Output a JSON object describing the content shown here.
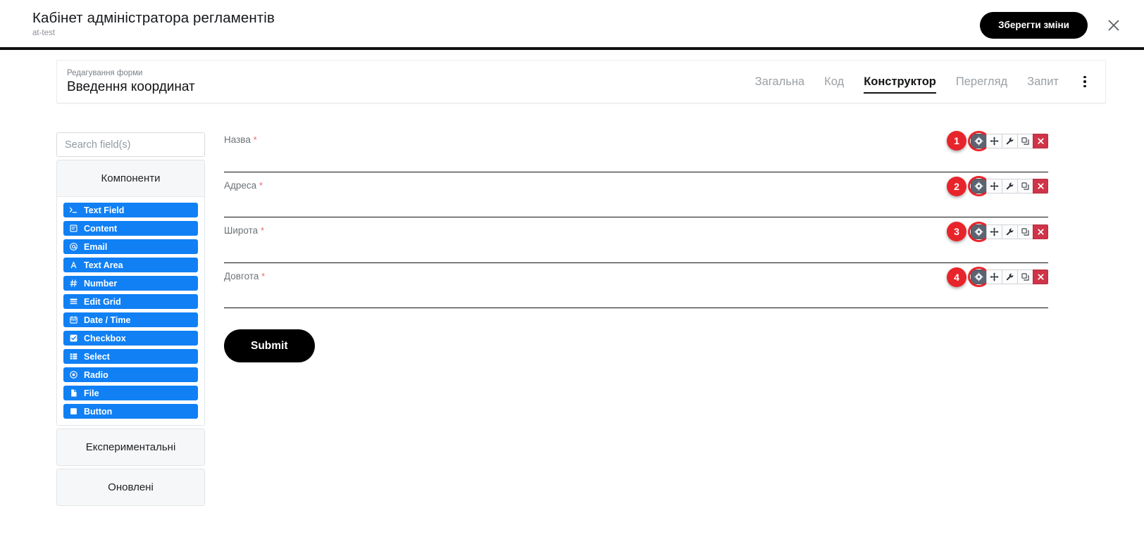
{
  "topbar": {
    "app_title": "Кабінет адміністратора регламентів",
    "app_subtitle": "at-test",
    "save_label": "Зберегти зміни",
    "close_icon": "close-icon"
  },
  "form_header": {
    "edit_label": "Редагування форми",
    "form_name": "Введення координат",
    "kebab_icon": "more-vertical-icon",
    "tabs": [
      {
        "label": "Загальна",
        "active": false
      },
      {
        "label": "Код",
        "active": false
      },
      {
        "label": "Конструктор",
        "active": true
      },
      {
        "label": "Перегляд",
        "active": false
      },
      {
        "label": "Запит",
        "active": false
      }
    ]
  },
  "sidebar": {
    "search_placeholder": "Search field(s)",
    "search_value": "",
    "panels": [
      {
        "title": "Компоненти",
        "expanded": true
      },
      {
        "title": "Експериментальні",
        "expanded": false
      },
      {
        "title": "Оновлені",
        "expanded": false
      }
    ],
    "components": [
      {
        "label": "Text Field",
        "icon": "terminal-icon"
      },
      {
        "label": "Content",
        "icon": "content-icon"
      },
      {
        "label": "Email",
        "icon": "at-icon"
      },
      {
        "label": "Text Area",
        "icon": "text-area-icon"
      },
      {
        "label": "Number",
        "icon": "hash-icon"
      },
      {
        "label": "Edit Grid",
        "icon": "grid-icon"
      },
      {
        "label": "Date / Time",
        "icon": "calendar-icon"
      },
      {
        "label": "Checkbox",
        "icon": "checkbox-icon"
      },
      {
        "label": "Select",
        "icon": "select-list-icon"
      },
      {
        "label": "Radio",
        "icon": "radio-icon"
      },
      {
        "label": "File",
        "icon": "file-icon"
      },
      {
        "label": "Button",
        "icon": "button-icon"
      }
    ]
  },
  "canvas": {
    "required_marker": "*",
    "fields": [
      {
        "badge": "1",
        "label": "Назва",
        "required": true
      },
      {
        "badge": "2",
        "label": "Адреса",
        "required": true
      },
      {
        "badge": "3",
        "label": "Широта",
        "required": true
      },
      {
        "badge": "4",
        "label": "Довгота",
        "required": true
      }
    ],
    "field_actions": [
      {
        "icon": "gear-icon",
        "name": "edit-settings"
      },
      {
        "icon": "move-icon",
        "name": "move"
      },
      {
        "icon": "wrench-icon",
        "name": "configure"
      },
      {
        "icon": "copy-icon",
        "name": "copy"
      },
      {
        "icon": "close-icon",
        "name": "remove"
      }
    ],
    "submit_label": "Submit"
  },
  "colors": {
    "accent_blue": "#1080f4",
    "badge_red": "#e8242b",
    "danger_red": "#cf3448",
    "black": "#000000"
  }
}
